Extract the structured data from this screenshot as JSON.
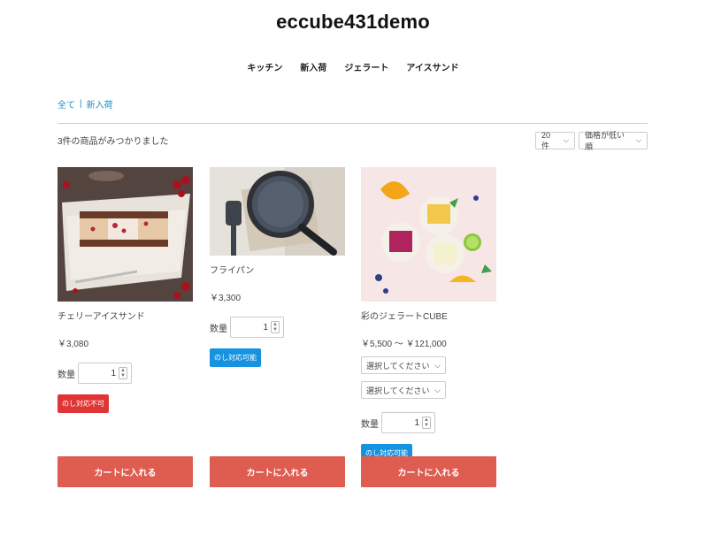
{
  "site": {
    "title": "eccube431demo"
  },
  "nav": {
    "items": [
      "キッチン",
      "新入荷",
      "ジェラート",
      "アイスサンド"
    ]
  },
  "breadcrumb": {
    "items": [
      "全て",
      "新入荷"
    ],
    "separator": "|"
  },
  "results": {
    "count_text": "3件の商品がみつかりました",
    "display_select": "20件",
    "order_select": "価格が低い順"
  },
  "products": [
    {
      "name": "チェリーアイスサンド",
      "price": "￥3,080",
      "qty_label": "数量",
      "qty_value": "1",
      "badge": "のし対応不可",
      "cart_label": "カートに入れる"
    },
    {
      "name": "フライパン",
      "price": "￥3,300",
      "qty_label": "数量",
      "qty_value": "1",
      "badge": "のし対応可能",
      "cart_label": "カートに入れる"
    },
    {
      "name": "彩のジェラートCUBE",
      "price": "￥5,500 ～ ￥121,000",
      "option1": "選択してください",
      "option2": "選択してください",
      "qty_label": "数量",
      "qty_value": "1",
      "badge": "のし対応可能",
      "cart_label": "カートに入れる"
    }
  ],
  "colors": {
    "accent": "#de5d50",
    "badge_red": "#e03535",
    "badge_blue": "#1592e0",
    "link": "#1a8fc9"
  }
}
